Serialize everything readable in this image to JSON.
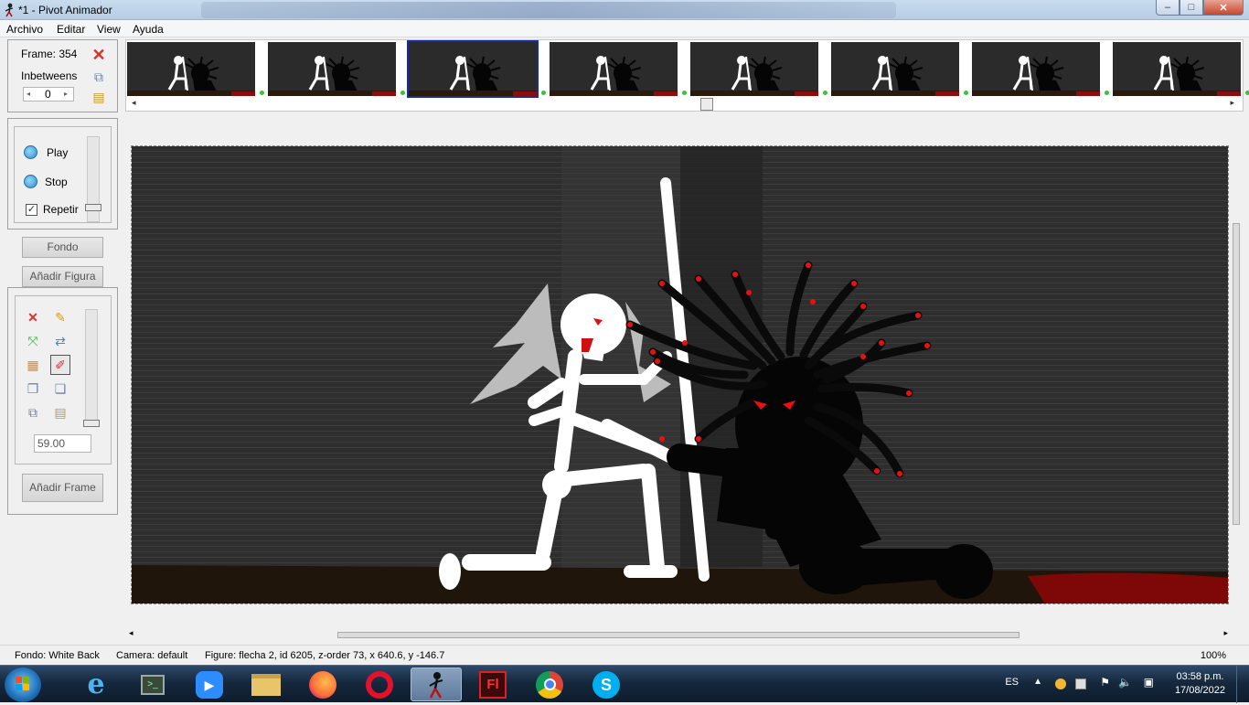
{
  "window": {
    "title": "*1 - Pivot Animador",
    "min": "–",
    "max": "□",
    "close": "✕"
  },
  "menu": [
    "Archivo",
    "Editar",
    "View",
    "Ayuda"
  ],
  "frame_panel": {
    "frame_label": "Frame: 354",
    "inbetweens_label": "Inbetweens",
    "inbetweens_value": "0"
  },
  "playback": {
    "play": "Play",
    "stop": "Stop",
    "repeat": "Repetir",
    "repeat_checked": true
  },
  "buttons": {
    "fondo": "Fondo",
    "add_figure": "Añadir Figura",
    "add_frame": "Añadir Frame"
  },
  "tools": {
    "scale_value": "59.00"
  },
  "thumbnails": {
    "count": 8,
    "selected_index": 2
  },
  "status": {
    "background": "Fondo: White Back",
    "camera": "Camera: default",
    "figure": "Figure: flecha 2,  id 6205,  z-order 73,  x 640.6, y -146.7",
    "zoom": "100%"
  },
  "taskbar": {
    "apps": [
      "internet-explorer",
      "terminal",
      "zoom",
      "file-explorer",
      "firefox",
      "opera",
      "pivot-animator",
      "flash",
      "chrome",
      "skype"
    ],
    "active_app": "pivot-animator",
    "language": "ES",
    "time": "03:58 p.m.",
    "date": "17/08/2022"
  },
  "colors": {
    "accent": "#1a2aa0",
    "stage_bg": "#2d2d2d",
    "ground": "#1e140a",
    "blood": "#8b0a0a",
    "eyes": "#e01010"
  }
}
